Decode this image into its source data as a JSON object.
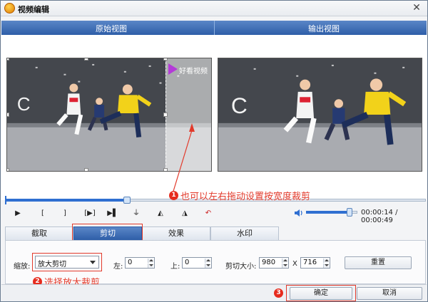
{
  "window": {
    "title": "视频编辑",
    "close": "✕"
  },
  "headers": {
    "original": "原始视图",
    "output": "输出视图"
  },
  "logo": {
    "text": "好看视频"
  },
  "playback": {
    "position_fraction": 0.29,
    "volume_fraction": 0.85,
    "time_current": "00:00:14",
    "time_total": "00:00:49",
    "time_sep": " / ",
    "buttons": [
      "▶",
      "[",
      "]",
      "[▶]",
      "▶▌",
      "⏚",
      "◭",
      "◮",
      "↶"
    ]
  },
  "tabs": [
    {
      "label": "截取",
      "active": false
    },
    {
      "label": "剪切",
      "active": true
    },
    {
      "label": "效果",
      "active": false
    },
    {
      "label": "水印",
      "active": false
    }
  ],
  "crop": {
    "zoom_label": "缩放:",
    "zoom_value": "放大剪切",
    "left_label": "左:",
    "left_value": "0",
    "top_label": "上:",
    "top_value": "0",
    "size_label": "剪切大小:",
    "width_value": "980",
    "x_label": "X",
    "height_value": "716",
    "reset_label": "重置"
  },
  "footer": {
    "ok_label": "确定",
    "cancel_label": "取消"
  },
  "annotations": [
    {
      "num": "1",
      "text": "也可以左右拖动设置按宽度裁剪"
    },
    {
      "num": "2",
      "text": "选择放大裁剪"
    },
    {
      "num": "3",
      "text": ""
    }
  ],
  "colors": {
    "accent": "#2e5ea8",
    "annotation": "#e23a2b"
  }
}
